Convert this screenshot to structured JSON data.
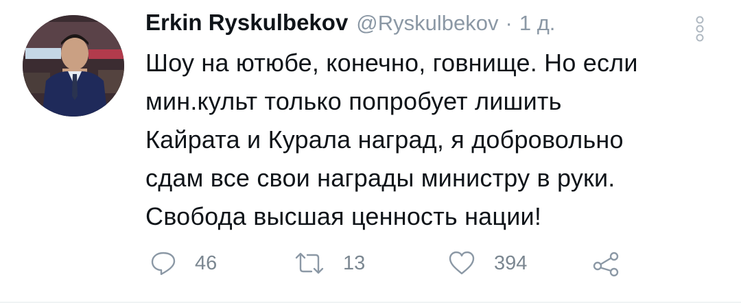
{
  "tweet": {
    "author": {
      "display_name": "Erkin Ryskulbekov",
      "handle": "@Ryskulbekov",
      "avatar_icon": "avatar-photo"
    },
    "separator": "·",
    "time": "1 д.",
    "menu_icon": "more-vertical-icon",
    "text_lines": [
      "Шоу на ютюбе, конечно, говнище. Но если",
      "мин.культ только попробует лишить",
      "Кайрата и Курала наград, я добровольно",
      "сдам все свои награды министру в руки.",
      "Свобода высшая ценность нации!"
    ],
    "actions": {
      "reply": {
        "icon": "reply-icon",
        "count": "46"
      },
      "retweet": {
        "icon": "retweet-icon",
        "count": "13"
      },
      "like": {
        "icon": "heart-icon",
        "count": "394"
      },
      "share": {
        "icon": "share-icon"
      }
    }
  },
  "colors": {
    "text": "#0f1419",
    "secondary": "#8b98a5",
    "background": "#ffffff"
  }
}
